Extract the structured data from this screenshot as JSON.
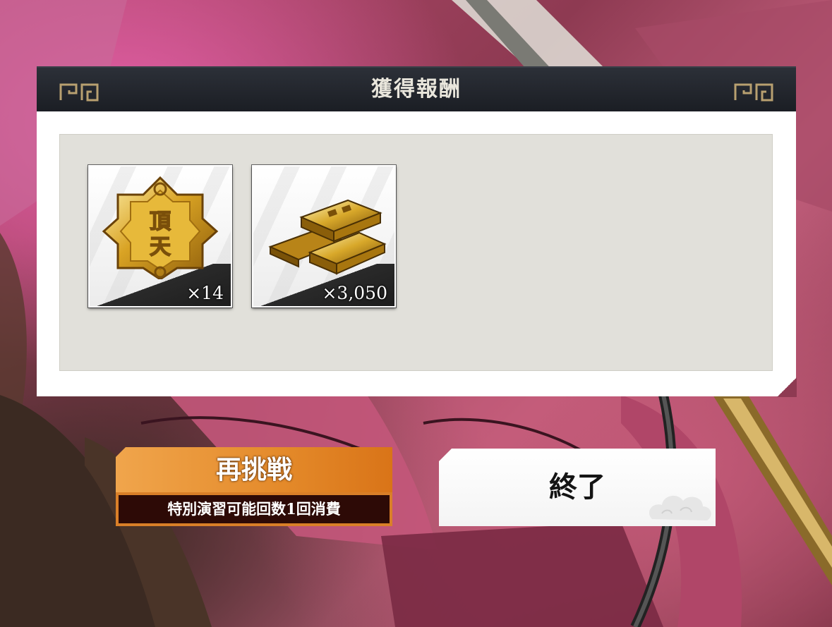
{
  "dialog": {
    "title": "獲得報酬"
  },
  "rewards": [
    {
      "icon": "emblem-medal-icon",
      "emblem_text": "頂天",
      "count": "×14"
    },
    {
      "icon": "gold-bars-icon",
      "count": "×3,050"
    }
  ],
  "buttons": {
    "retry": {
      "label": "再挑戦",
      "sub_label": "特別演習可能回数1回消費"
    },
    "end": {
      "label": "終了"
    }
  },
  "colors": {
    "header_bg": "#1b1e24",
    "retry_orange": "#e48a2a",
    "retry_sub_bg": "#2d0a06",
    "panel_bg": "#e1e0da"
  }
}
